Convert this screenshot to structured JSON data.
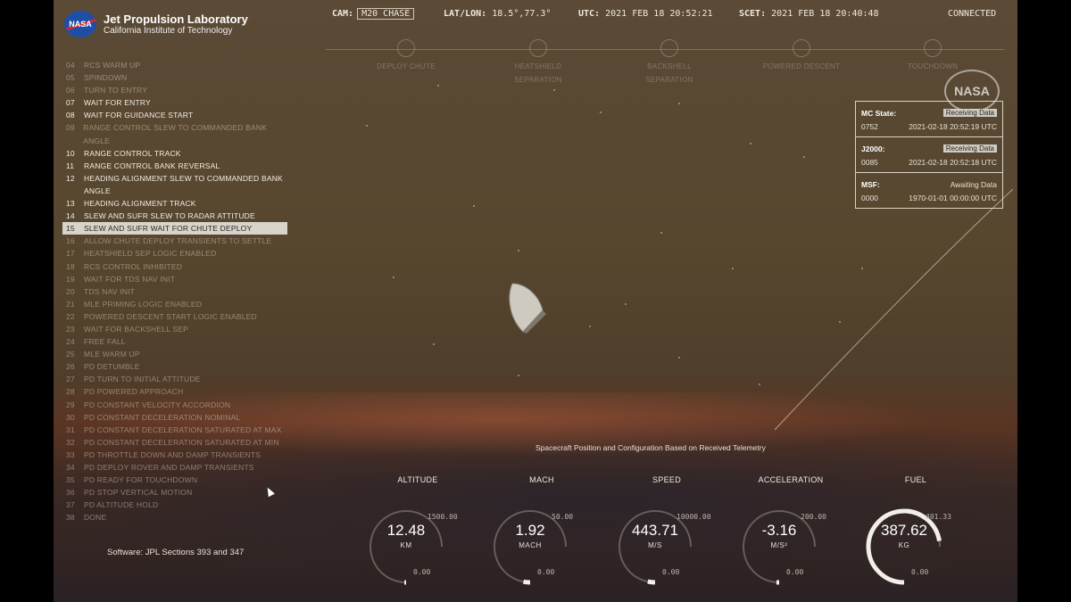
{
  "logo": {
    "badge": "NASA",
    "line1": "Jet Propulsion Laboratory",
    "line2": "California Institute of Technology"
  },
  "topbar": {
    "cam_label": "CAM:",
    "cam_value": "M20 CHASE",
    "latlon_label": "LAT/LON:",
    "latlon_value": "18.5°,77.3°",
    "utc_label": "UTC:",
    "utc_value": "2021 FEB 18 20:52:21",
    "scet_label": "SCET:",
    "scet_value": "2021 FEB 18 20:40:48",
    "connection": "CONNECTED"
  },
  "phases": [
    {
      "icon": "parachute-icon",
      "label1": "DEPLOY CHUTE",
      "label2": ""
    },
    {
      "icon": "heatshield-icon",
      "label1": "HEATSHIELD",
      "label2": "SEPARATION"
    },
    {
      "icon": "backshell-icon",
      "label1": "BACKSHELL",
      "label2": "SEPARATION"
    },
    {
      "icon": "rocket-icon",
      "label1": "POWERED DESCENT",
      "label2": ""
    },
    {
      "icon": "touchdown-icon",
      "label1": "TOUCHDOWN",
      "label2": ""
    }
  ],
  "events": [
    {
      "num": "04",
      "text": "RCS WARM UP",
      "state": "pending"
    },
    {
      "num": "05",
      "text": "SPINDOWN",
      "state": "pending"
    },
    {
      "num": "06",
      "text": "TURN TO ENTRY",
      "state": "pending"
    },
    {
      "num": "07",
      "text": "WAIT FOR ENTRY",
      "state": "done"
    },
    {
      "num": "08",
      "text": "WAIT FOR GUIDANCE START",
      "state": "done"
    },
    {
      "num": "09",
      "text": "RANGE CONTROL SLEW TO COMMANDED BANK ANGLE",
      "state": "pending"
    },
    {
      "num": "10",
      "text": "RANGE CONTROL TRACK",
      "state": "done"
    },
    {
      "num": "11",
      "text": "RANGE CONTROL BANK REVERSAL",
      "state": "done"
    },
    {
      "num": "12",
      "text": "HEADING ALIGNMENT SLEW TO COMMANDED BANK",
      "state": "done"
    },
    {
      "num": "",
      "text": "ANGLE",
      "state": "done"
    },
    {
      "num": "13",
      "text": "HEADING ALIGNMENT TRACK",
      "state": "done"
    },
    {
      "num": "14",
      "text": "SLEW AND SUFR SLEW TO RADAR ATTITUDE",
      "state": "done"
    },
    {
      "num": "15",
      "text": "SLEW AND SUFR WAIT FOR CHUTE DEPLOY",
      "state": "active"
    },
    {
      "num": "16",
      "text": "ALLOW CHUTE DEPLOY TRANSIENTS TO SETTLE",
      "state": "pending"
    },
    {
      "num": "17",
      "text": "HEATSHIELD SEP LOGIC ENABLED",
      "state": "pending"
    },
    {
      "num": "18",
      "text": "RCS CONTROL INHIBITED",
      "state": "pending"
    },
    {
      "num": "19",
      "text": "WAIT FOR TDS NAV INIT",
      "state": "pending"
    },
    {
      "num": "20",
      "text": "TDS NAV INIT",
      "state": "pending"
    },
    {
      "num": "21",
      "text": "MLE PRIMING LOGIC ENABLED",
      "state": "pending"
    },
    {
      "num": "22",
      "text": "POWERED DESCENT START LOGIC ENABLED",
      "state": "pending"
    },
    {
      "num": "23",
      "text": "WAIT FOR BACKSHELL SEP",
      "state": "pending"
    },
    {
      "num": "24",
      "text": "FREE FALL",
      "state": "pending"
    },
    {
      "num": "25",
      "text": "MLE WARM UP",
      "state": "pending"
    },
    {
      "num": "26",
      "text": "PD DETUMBLE",
      "state": "pending"
    },
    {
      "num": "27",
      "text": "PD TURN TO INITIAL ATTITUDE",
      "state": "pending"
    },
    {
      "num": "28",
      "text": "PD POWERED APPROACH",
      "state": "pending"
    },
    {
      "num": "29",
      "text": "PD CONSTANT VELOCITY ACCORDION",
      "state": "pending"
    },
    {
      "num": "30",
      "text": "PD CONSTANT DECELERATION NOMINAL",
      "state": "pending"
    },
    {
      "num": "31",
      "text": "PD CONSTANT DECELERATION SATURATED AT MAX",
      "state": "pending"
    },
    {
      "num": "32",
      "text": "PD CONSTANT DECELERATION SATURATED AT MIN",
      "state": "pending"
    },
    {
      "num": "33",
      "text": "PD THROTTLE DOWN AND DAMP TRANSIENTS",
      "state": "pending"
    },
    {
      "num": "34",
      "text": "PD DEPLOY ROVER AND DAMP TRANSIENTS",
      "state": "pending"
    },
    {
      "num": "35",
      "text": "PD READY FOR TOUCHDOWN",
      "state": "pending"
    },
    {
      "num": "36",
      "text": "PD STOP VERTICAL MOTION",
      "state": "pending"
    },
    {
      "num": "37",
      "text": "PD ALTITUDE HOLD",
      "state": "pending"
    },
    {
      "num": "38",
      "text": "DONE",
      "state": "pending"
    }
  ],
  "software": "Software: JPL Sections 393 and 347",
  "status_panel": {
    "mc": {
      "title": "MC State:",
      "status": "Receiving Data",
      "id": "0752",
      "time": "2021-02-18 20:52:19 UTC"
    },
    "j2000": {
      "title": "J2000:",
      "status": "Receiving Data",
      "id": "0085",
      "time": "2021-02-18 20:52:18 UTC"
    },
    "msf": {
      "title": "MSF:",
      "status": "Awaiting Data",
      "id": "0000",
      "time": "1970-01-01 00:00:00 UTC"
    }
  },
  "nasa_worm": "NASA",
  "caption": "Spacecraft Position and Configuration Based on Received Telemetry",
  "gauges": [
    {
      "label": "ALTITUDE",
      "value": "12.48",
      "unit": "KM",
      "max": "1500.00",
      "min": "0.00",
      "fraction": 0.008
    },
    {
      "label": "MACH",
      "value": "1.92",
      "unit": "MACH",
      "max": "50.00",
      "min": "0.00",
      "fraction": 0.04
    },
    {
      "label": "SPEED",
      "value": "443.71",
      "unit": "M/S",
      "max": "10000.00",
      "min": "0.00",
      "fraction": 0.044
    },
    {
      "label": "ACCELERATION",
      "value": "-3.16",
      "unit": "M/S²",
      "max": "200.00",
      "min": "0.00",
      "fraction": 0.016
    },
    {
      "label": "FUEL",
      "value": "387.62",
      "unit": "KG",
      "max": "401.33",
      "min": "0.00",
      "fraction": 0.966
    }
  ]
}
